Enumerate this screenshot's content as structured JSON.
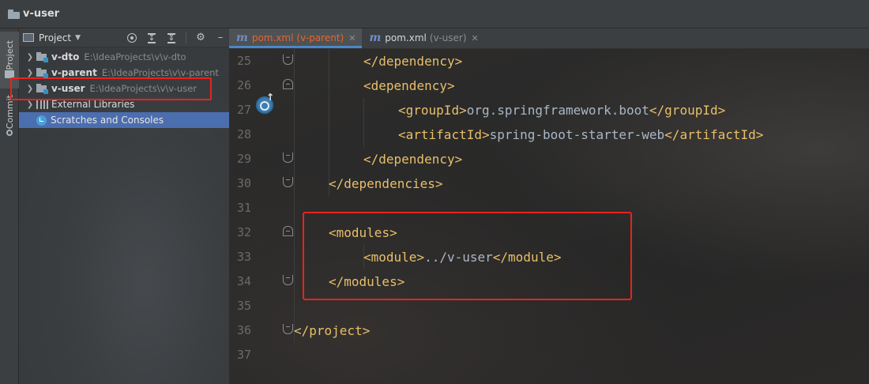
{
  "window": {
    "title": "v-user"
  },
  "toolstrip": {
    "project_label": "Project",
    "commit_label": "Commit"
  },
  "project_panel": {
    "title": "Project",
    "tree": [
      {
        "name": "v-dto",
        "path": "E:\\IdeaProjects\\v\\v-dto",
        "icon": "module-folder-icon"
      },
      {
        "name": "v-parent",
        "path": "E:\\IdeaProjects\\v\\v-parent",
        "icon": "module-folder-icon"
      },
      {
        "name": "v-user",
        "path": "E:\\IdeaProjects\\v\\v-user",
        "icon": "module-folder-icon"
      },
      {
        "name": "External Libraries",
        "path": "",
        "icon": "library-icon"
      },
      {
        "name": "Scratches and Consoles",
        "path": "",
        "icon": "scratch-icon"
      }
    ]
  },
  "editor": {
    "tabs": [
      {
        "label": "pom.xml",
        "module": "(v-parent)",
        "active": true
      },
      {
        "label": "pom.xml",
        "module": "(v-user)",
        "active": false
      }
    ],
    "lines": [
      {
        "n": "25",
        "open": "</",
        "tag": "dependency",
        "close": ">"
      },
      {
        "n": "26",
        "open": "<",
        "tag": "dependency",
        "close": ">"
      },
      {
        "n": "27",
        "open": "<",
        "tag": "groupId",
        "close": ">",
        "text": "org.springframework.boot",
        "open2": "</",
        "tag2": "groupId",
        "close2": ">"
      },
      {
        "n": "28",
        "open": "<",
        "tag": "artifactId",
        "close": ">",
        "text": "spring-boot-starter-web",
        "open2": "</",
        "tag2": "artifactId",
        "close2": ">"
      },
      {
        "n": "29",
        "open": "</",
        "tag": "dependency",
        "close": ">"
      },
      {
        "n": "30",
        "open": "</",
        "tag": "dependencies",
        "close": ">"
      },
      {
        "n": "31"
      },
      {
        "n": "32",
        "open": "<",
        "tag": "modules",
        "close": ">"
      },
      {
        "n": "33",
        "open": "<",
        "tag": "module",
        "close": ">",
        "text": "../v-user",
        "open2": "</",
        "tag2": "module",
        "close2": ">"
      },
      {
        "n": "34",
        "open": "</",
        "tag": "modules",
        "close": ">"
      },
      {
        "n": "35"
      },
      {
        "n": "36",
        "open": "</",
        "tag": "project",
        "close": ">"
      },
      {
        "n": "37"
      }
    ]
  },
  "colors": {
    "tag": "#e8bf6a",
    "text": "#a9b7c6",
    "highlight": "#e8231d",
    "selection": "#4b6eaf",
    "active_tab_text": "#e7652f"
  }
}
